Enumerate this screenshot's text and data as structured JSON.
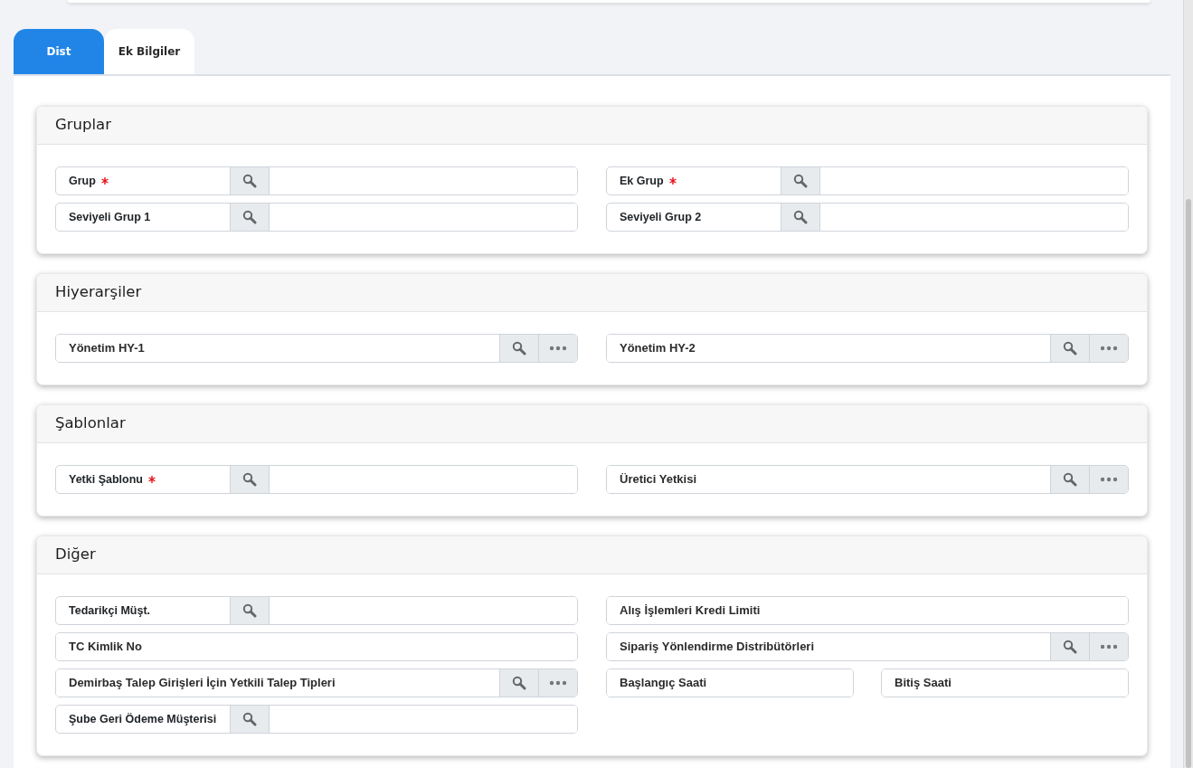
{
  "tabs": [
    {
      "label": "Dist",
      "selected": true
    },
    {
      "label": "Ek Bilgiler",
      "selected": false
    }
  ],
  "sections": [
    {
      "title": "Gruplar",
      "left": [
        {
          "kind": "lookup",
          "label": "Grup",
          "required": true
        },
        {
          "kind": "lookup",
          "label": "Seviyeli Grup 1",
          "required": false
        }
      ],
      "right": [
        {
          "kind": "lookup",
          "label": "Ek Grup",
          "required": true
        },
        {
          "kind": "lookup",
          "label": "Seviyeli Grup 2",
          "required": false
        }
      ]
    },
    {
      "title": "Hiyerarşiler",
      "left": [
        {
          "kind": "picker",
          "placeholder": "Yönetim HY-1"
        }
      ],
      "right": [
        {
          "kind": "picker",
          "placeholder": "Yönetim HY-2"
        }
      ]
    },
    {
      "title": "Şablonlar",
      "left": [
        {
          "kind": "lookup",
          "label": "Yetki Şablonu",
          "required": true
        }
      ],
      "right": [
        {
          "kind": "picker",
          "placeholder": "Üretici Yetkisi"
        }
      ]
    },
    {
      "title": "Diğer",
      "left": [
        {
          "kind": "lookup",
          "label": "Tedarikçi Müşt.",
          "required": false
        },
        {
          "kind": "text",
          "placeholder": "TC Kimlik No"
        },
        {
          "kind": "picker",
          "placeholder": "Demirbaş Talep Girişleri İçin Yetkili Talep Tipleri"
        },
        {
          "kind": "lookup",
          "label": "Şube Geri Ödeme Müşterisi",
          "required": false
        }
      ],
      "right": [
        {
          "kind": "text",
          "placeholder": "Alış İşlemleri Kredi Limiti"
        },
        {
          "kind": "picker",
          "placeholder": "Sipariş Yönlendirme Distribütörleri"
        },
        {
          "kind": "split",
          "fields": [
            {
              "kind": "text",
              "placeholder": "Başlangıç Saati"
            },
            {
              "kind": "text",
              "placeholder": "Bitiş Saati"
            }
          ]
        }
      ]
    }
  ]
}
